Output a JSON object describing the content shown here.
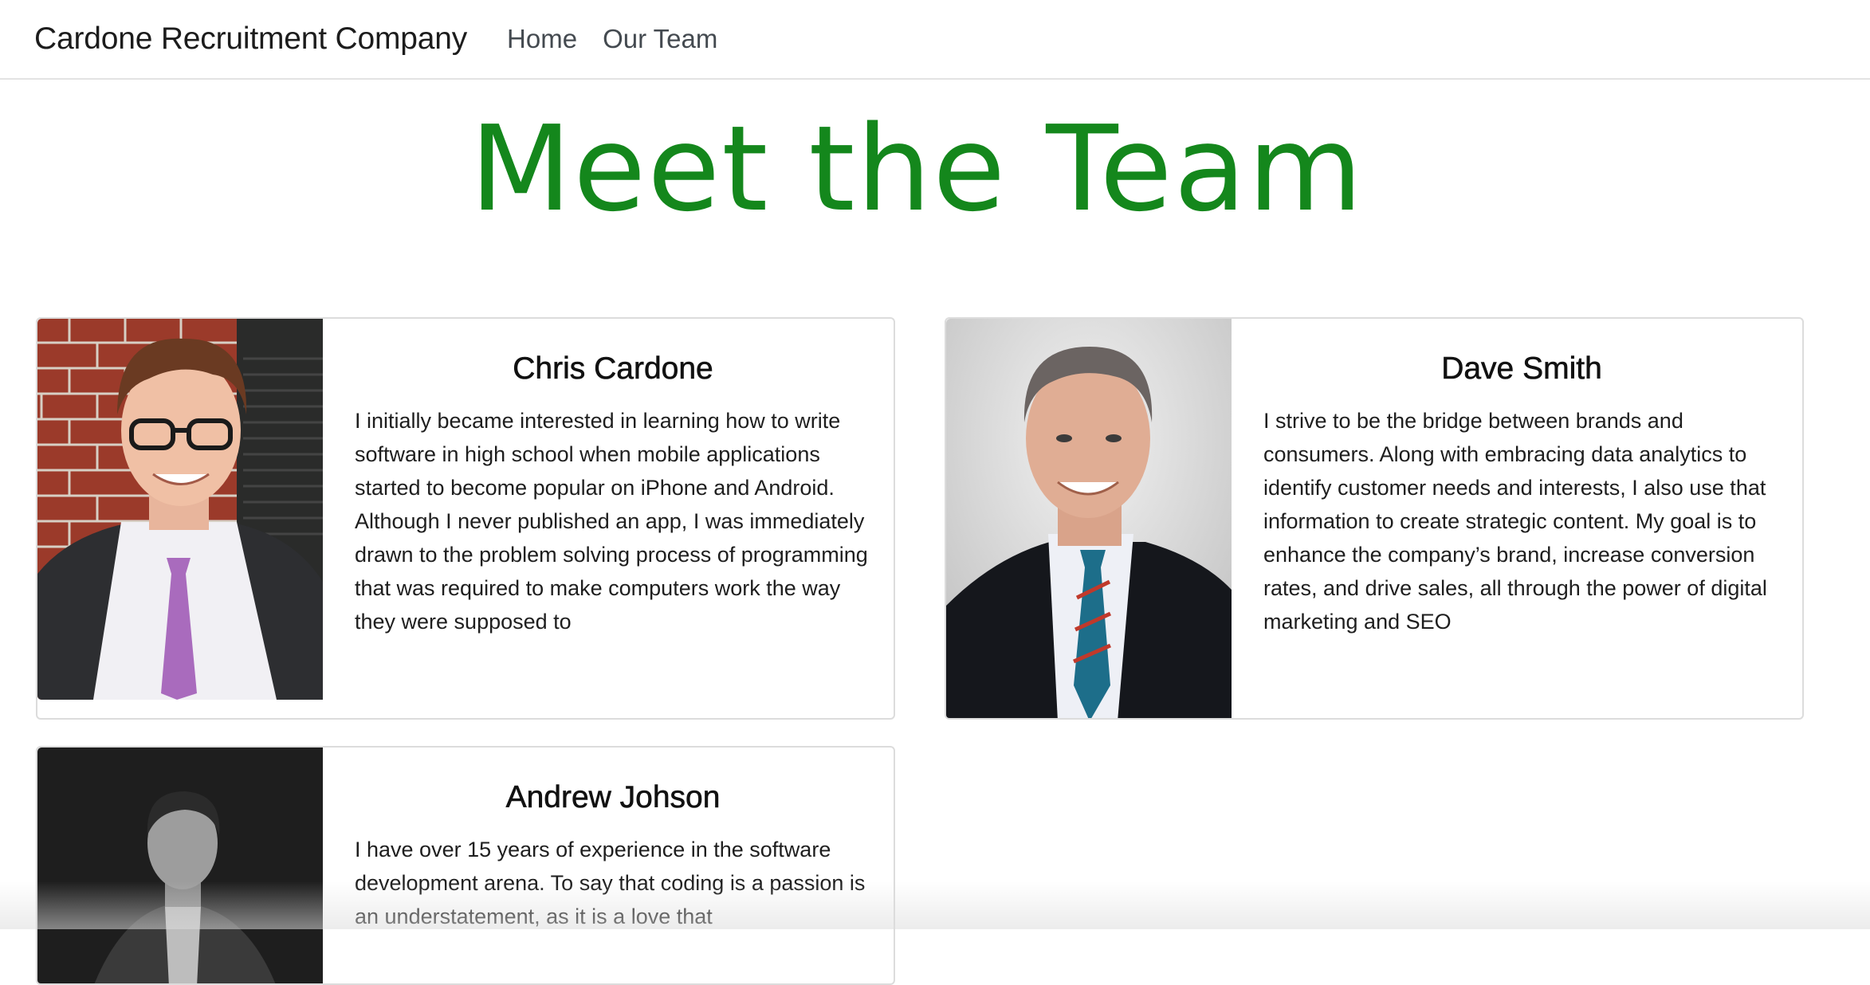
{
  "nav": {
    "brand": "Cardone Recruitment Company",
    "links": [
      "Home",
      "Our Team"
    ]
  },
  "page": {
    "title": "Meet the Team"
  },
  "team": [
    {
      "name": "Chris Cardone",
      "bio": "I initially became interested in learning how to write software in high school when mobile applications started to become popular on iPhone and Android. Although I never published an app, I was immediately drawn to the problem solving process of programming that was required to make computers work the way they were supposed to"
    },
    {
      "name": "Dave Smith",
      "bio": "I strive to be the bridge between brands and consumers. Along with embracing data analytics to identify customer needs and interests, I also use that information to create strategic content. My goal is to enhance the company’s brand, increase conversion rates, and drive sales, all through the power of digital marketing and SEO"
    },
    {
      "name": "Andrew Johson",
      "bio": "I have over 15 years of experience in the software development arena. To say that coding is a passion is an understatement, as it is a love that"
    }
  ],
  "colors": {
    "title_green": "#14871c",
    "card_border": "#dcdcdc"
  }
}
